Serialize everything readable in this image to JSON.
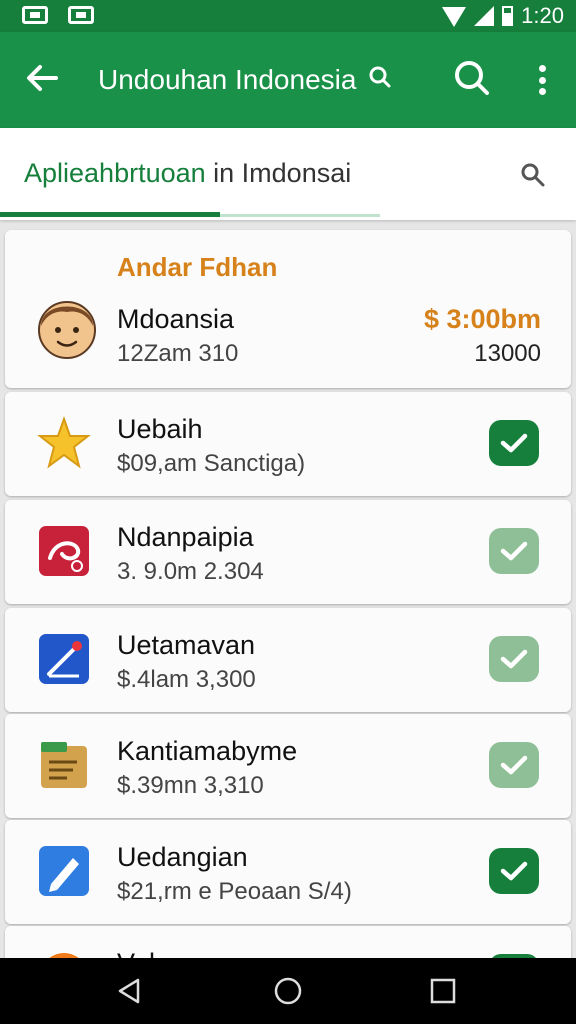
{
  "status_bar": {
    "time": "1:20"
  },
  "app_bar": {
    "title": "Undouhan Indonesia"
  },
  "search": {
    "query_highlight": "Aplieahbrtuoan",
    "query_rest": " in Imdonsai"
  },
  "featured": {
    "label": "Andar Fdhan",
    "name": "Mdoansia",
    "subtitle": "12Zam 310",
    "price": "$ 3:00bm",
    "count": "13000"
  },
  "items": [
    {
      "name": "Uebaih",
      "subtitle": "$09,am Sanctiga)",
      "checked": true,
      "icon": "star-icon"
    },
    {
      "name": "Ndanpaipia",
      "subtitle": "3. 9.0m 2.304",
      "checked": false,
      "icon": "red-app-icon"
    },
    {
      "name": "Uetamavan",
      "subtitle": "$.4lam 3,300",
      "checked": false,
      "icon": "blue-arrow-app-icon"
    },
    {
      "name": "Kantiamabyme",
      "subtitle": "$.39mn 3,310",
      "checked": false,
      "icon": "document-app-icon"
    },
    {
      "name": "Uedangian",
      "subtitle": "$21,rm e Peoaan S/4)",
      "checked": true,
      "icon": "pen-app-icon"
    },
    {
      "name": "Vuku",
      "subtitle": "",
      "checked": true,
      "icon": "orange-app-icon"
    }
  ],
  "colors": {
    "primary": "#199148",
    "primary_dark": "#157f3b",
    "accent": "#d6811a",
    "check_on": "#157f3b",
    "check_off": "#8fbf96"
  }
}
